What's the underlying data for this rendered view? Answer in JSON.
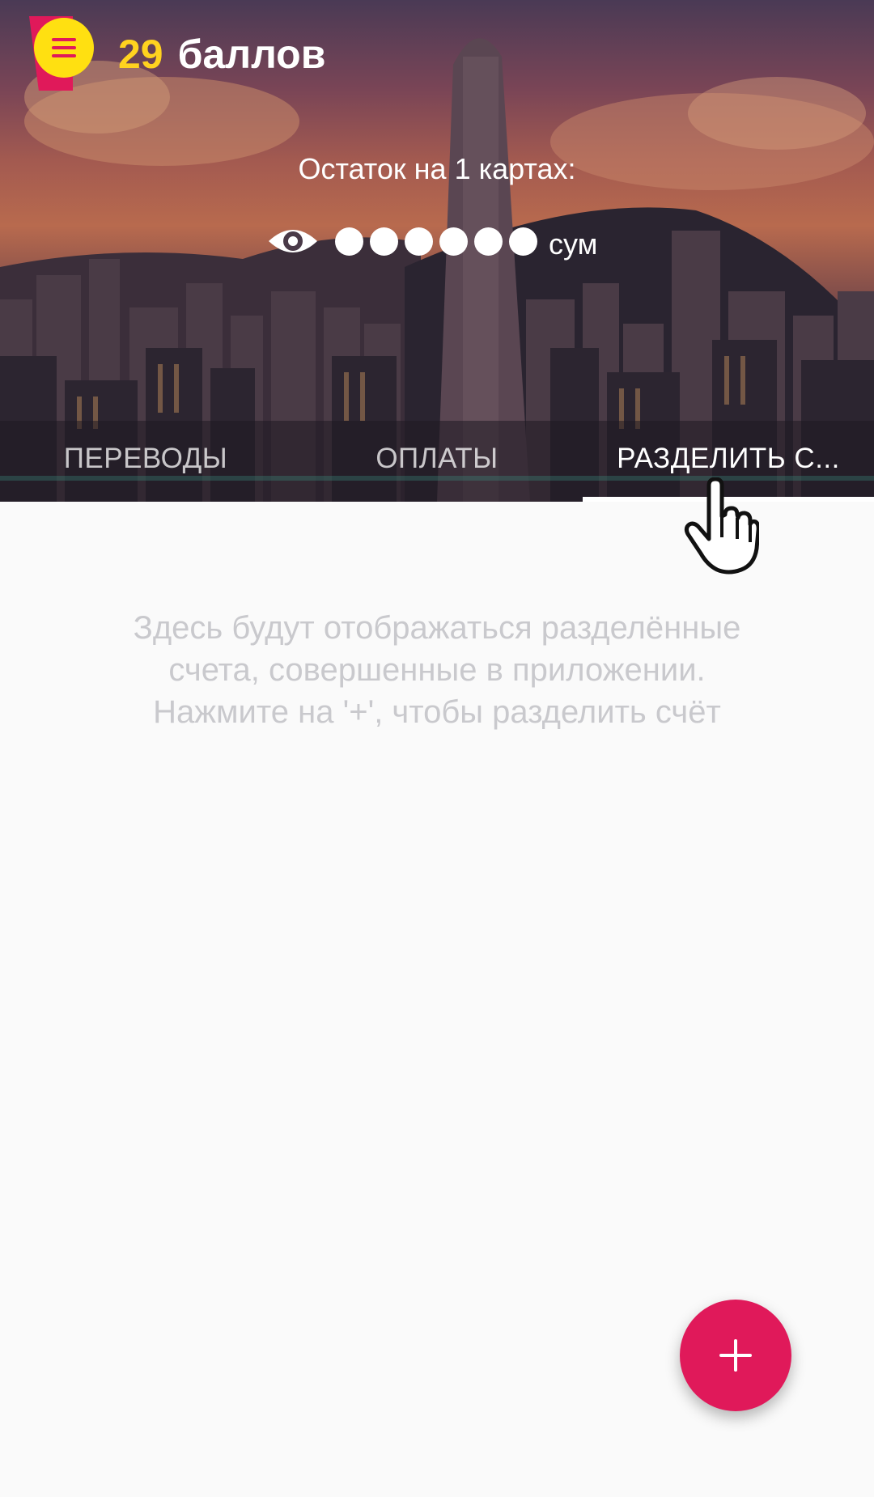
{
  "header": {
    "points_value": "29",
    "points_label": "баллов",
    "balance_caption": "Остаток на 1 картах:",
    "balance_masked_dots": 6,
    "currency": "сум",
    "icons": {
      "menu": "menu-icon",
      "visibility": "eye-icon"
    }
  },
  "tabs": [
    {
      "label": "ПЕРЕВОДЫ",
      "active": false
    },
    {
      "label": "ОПЛАТЫ",
      "active": false
    },
    {
      "label": "РАЗДЕЛИТЬ С...",
      "active": true
    }
  ],
  "main": {
    "empty_line1": "Здесь будут отображаться разделённые",
    "empty_line2": "счета, совершенные в приложении.",
    "empty_line3": "Нажмите на '+', чтобы разделить счёт"
  },
  "fab": {
    "icon": "plus-icon"
  },
  "colors": {
    "accent": "#e0195a",
    "points": "#ffd21f",
    "menu_circle": "#ffe011",
    "empty_text": "#c9c9cd",
    "background": "#fafafa"
  }
}
